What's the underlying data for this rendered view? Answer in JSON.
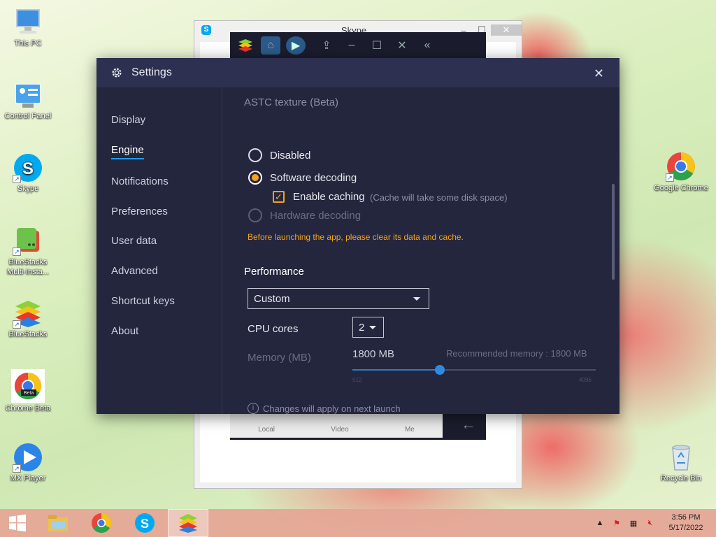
{
  "desktop": {
    "icons_left": [
      {
        "label": "This PC",
        "icon": "computer-icon"
      },
      {
        "label": "Control Panel",
        "icon": "control-panel-icon"
      },
      {
        "label": "Skype",
        "icon": "skype-icon"
      },
      {
        "label": "BlueStacks Multi-Insta...",
        "icon": "bluestacks-multi-icon"
      },
      {
        "label": "BlueStacks",
        "icon": "bluestacks-icon"
      },
      {
        "label": "Chrome Beta",
        "icon": "chrome-beta-icon"
      },
      {
        "label": "MX Player",
        "icon": "mx-player-icon"
      }
    ],
    "icons_right": [
      {
        "label": "Google Chrome",
        "icon": "chrome-icon"
      },
      {
        "label": "Recycle Bin",
        "icon": "recycle-bin-icon"
      }
    ],
    "chrome_beta_badge": "Beta"
  },
  "skype_window": {
    "title": "Skype",
    "minimize": "–",
    "maximize": "☐",
    "close": "✕"
  },
  "bluestacks_bg": {
    "tabs": [
      "Local",
      "Video",
      "Me"
    ]
  },
  "settings": {
    "title": "Settings",
    "close_label": "✕",
    "nav": [
      {
        "label": "Display",
        "active": false
      },
      {
        "label": "Engine",
        "active": true
      },
      {
        "label": "Notifications",
        "active": false
      },
      {
        "label": "Preferences",
        "active": false
      },
      {
        "label": "User data",
        "active": false
      },
      {
        "label": "Advanced",
        "active": false
      },
      {
        "label": "Shortcut keys",
        "active": false
      },
      {
        "label": "About",
        "active": false
      }
    ],
    "astc": {
      "heading": "ASTC texture (Beta)",
      "options": [
        {
          "label": "Disabled",
          "state": "off"
        },
        {
          "label": "Software decoding",
          "state": "on"
        },
        {
          "label": "Hardware decoding",
          "state": "disabled"
        }
      ],
      "caching_label": "Enable caching",
      "caching_checked": true,
      "caching_note": "(Cache will take some disk space)",
      "warning": "Before launching the app, please clear its data and cache."
    },
    "performance": {
      "heading": "Performance",
      "preset": "Custom",
      "cpu_label": "CPU cores",
      "cpu_value": "2",
      "memory_label": "Memory (MB)",
      "memory_value": "1800 MB",
      "recommended": "Recommended memory : 1800 MB",
      "slider_min": "512",
      "slider_max": "4096",
      "slider_value": 1800
    },
    "footer_note": "Changes will apply on next launch"
  },
  "taskbar": {
    "apps": [
      "windows-start-icon",
      "file-explorer-icon",
      "chrome-icon",
      "skype-icon",
      "bluestacks-icon"
    ],
    "active_app": "bluestacks-icon",
    "time": "3:56 PM",
    "date": "5/17/2022"
  },
  "colors": {
    "settings_bg": "#24263d",
    "header_bg": "#2d3050",
    "accent_orange": "#f7a21b",
    "accent_blue": "#1e9bf0"
  }
}
